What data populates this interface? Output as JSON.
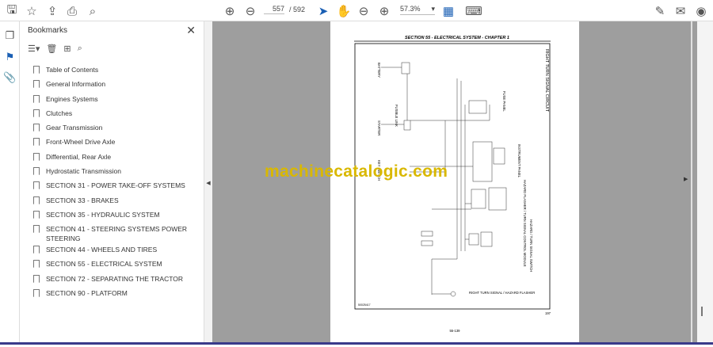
{
  "toolbar": {
    "page_current": "557",
    "page_total": "/ 592",
    "zoom": "57.3%"
  },
  "bookmarks": {
    "title": "Bookmarks",
    "items": [
      "Table of Contents",
      "General Information",
      "Engines Systems",
      "Clutches",
      "Gear Transmission",
      "Front-Wheel Drive Axle",
      "Differential, Rear Axle",
      "Hydrostatic Transmission",
      "SECTION 31 - POWER TAKE-OFF SYSTEMS",
      "SECTION 33 - BRAKES",
      "SECTION 35 - HYDRAULIC SYSTEM",
      "SECTION 41 - STEERING SYSTEMS POWER STEERING",
      "SECTION 44 - WHEELS AND TIRES",
      "SECTION 55 - ELECTRICAL SYSTEM",
      "SECTION 72 - SEPARATING THE TRACTOR",
      "SECTION 90 - PLATFORM"
    ]
  },
  "page": {
    "header": "SECTION 55 - ELECTRICAL SYSTEM - CHAPTER 1",
    "circuit_title": "RIGHT TURN SIGNAL CIRCUIT",
    "battery": "BATTERY",
    "fusible_link": "FUSIBLE LINK",
    "starter": "STARTER",
    "key_switch": "KEY SWITCH",
    "fuse_panel": "FUSE PANEL",
    "instrument_panel": "INSTRUMENT PANEL",
    "module": "HAZARD FLASHER / TURN SIGNAL CONTROL MODULE",
    "switch": "HAZARD / TURN SIGNAL SWITCH",
    "lamp": "RIGHT TURN SIGNAL / HAZARD FLASHER",
    "fig_id": "50025417",
    "fig_no": "197",
    "page_no": "55-139"
  },
  "watermark": "machinecatalogic.com"
}
